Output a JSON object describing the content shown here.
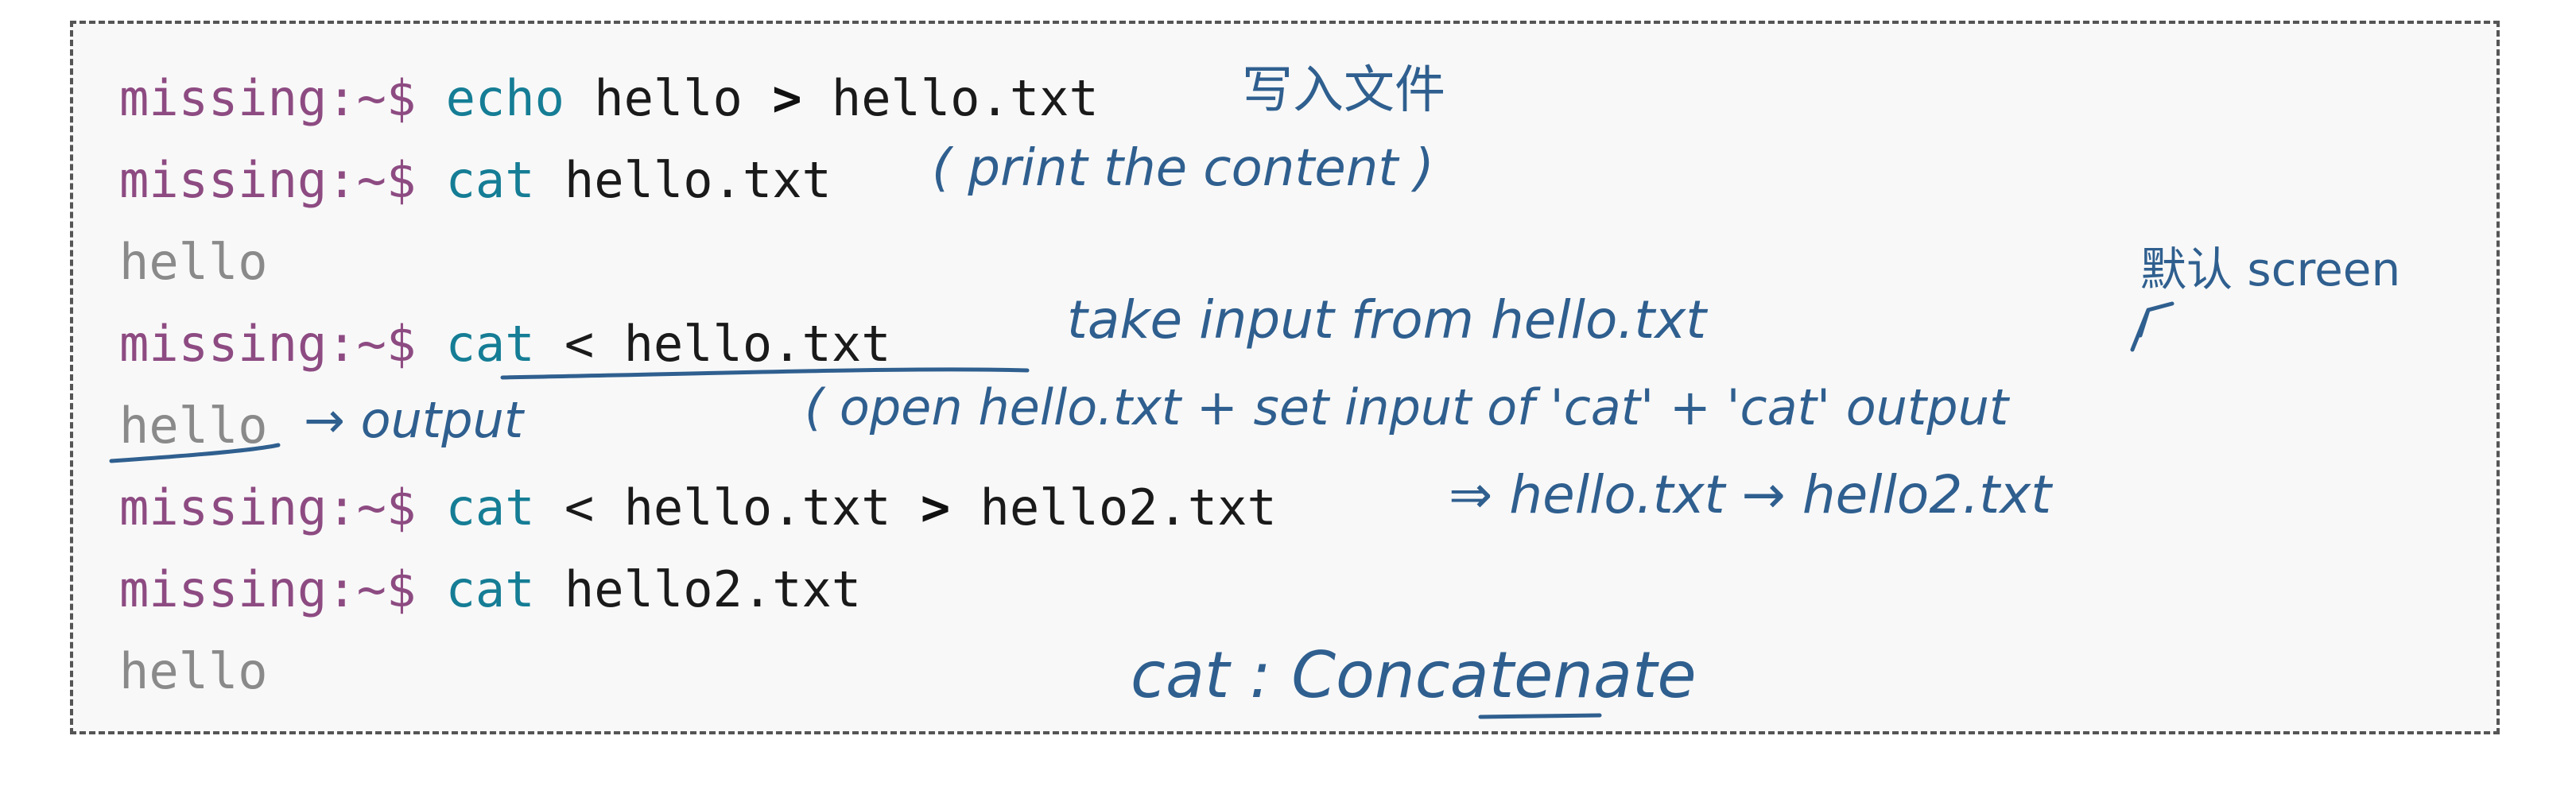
{
  "terminal": {
    "lines": [
      {
        "prompt": "missing:~$",
        "cmd": "echo",
        "parts": [
          " hello ",
          ">",
          " hello.txt"
        ]
      },
      {
        "prompt": "missing:~$",
        "cmd": "cat",
        "parts": [
          " hello.txt"
        ]
      },
      {
        "output": "hello"
      },
      {
        "prompt": "missing:~$",
        "cmd": "cat",
        "parts": [
          " < hello.txt"
        ]
      },
      {
        "output": "hello"
      },
      {
        "prompt": "missing:~$",
        "cmd": "cat",
        "parts": [
          " < hello.txt ",
          ">",
          " hello2.txt"
        ]
      },
      {
        "prompt": "missing:~$",
        "cmd": "cat",
        "parts": [
          " hello2.txt"
        ]
      },
      {
        "output": "hello"
      }
    ]
  },
  "annotations": {
    "write_file": "写入文件",
    "print_content": "( print the content )",
    "take_input": "take input from hello.txt",
    "default_screen": "默认 screen",
    "output": "→ output",
    "open_note": "( open hello.txt + set input of 'cat' + 'cat' output",
    "redirect_note": "⇒ hello.txt → hello2.txt",
    "cat_meaning": "cat : Concatenate"
  },
  "colors": {
    "prompt": "#8d4b82",
    "command": "#157d95",
    "output": "#8a8a8a",
    "ink": "#2f5f8f",
    "border": "#555555",
    "background": "#f8f8f8"
  }
}
